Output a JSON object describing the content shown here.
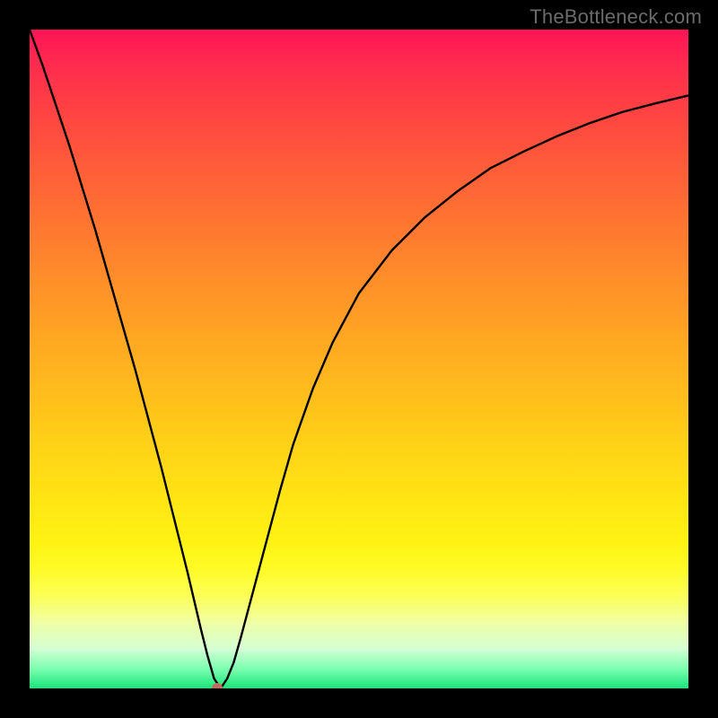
{
  "watermark": "TheBottleneck.com",
  "chart_data": {
    "type": "line",
    "title": "",
    "xlabel": "",
    "ylabel": "",
    "xlim": [
      0,
      1
    ],
    "ylim": [
      0,
      1
    ],
    "legend": false,
    "grid": false,
    "background": {
      "type": "vertical-gradient",
      "stops": [
        {
          "t": 0.0,
          "color": "#ff1456"
        },
        {
          "t": 0.2,
          "color": "#ff5a3a"
        },
        {
          "t": 0.47,
          "color": "#ffa722"
        },
        {
          "t": 0.72,
          "color": "#ffe613"
        },
        {
          "t": 0.86,
          "color": "#f0ffa4"
        },
        {
          "t": 1.0,
          "color": "#18e47a"
        }
      ]
    },
    "annotations": [
      {
        "name": "minimum-marker",
        "x": 0.285,
        "y": 0.0,
        "color": "#c46b5a",
        "shape": "dot"
      }
    ],
    "series": [
      {
        "name": "bottleneck-curve",
        "color": "#000000",
        "x": [
          0.0,
          0.02,
          0.04,
          0.06,
          0.08,
          0.1,
          0.12,
          0.14,
          0.16,
          0.18,
          0.2,
          0.22,
          0.24,
          0.26,
          0.27,
          0.28,
          0.29,
          0.3,
          0.31,
          0.32,
          0.34,
          0.36,
          0.38,
          0.4,
          0.43,
          0.46,
          0.5,
          0.55,
          0.6,
          0.65,
          0.7,
          0.75,
          0.8,
          0.85,
          0.9,
          0.95,
          1.0
        ],
        "y": [
          1.0,
          0.945,
          0.885,
          0.825,
          0.76,
          0.695,
          0.625,
          0.555,
          0.485,
          0.41,
          0.335,
          0.255,
          0.175,
          0.09,
          0.05,
          0.015,
          0.0,
          0.015,
          0.04,
          0.075,
          0.15,
          0.225,
          0.3,
          0.37,
          0.455,
          0.525,
          0.6,
          0.665,
          0.715,
          0.755,
          0.79,
          0.815,
          0.838,
          0.858,
          0.875,
          0.888,
          0.9
        ]
      }
    ]
  }
}
